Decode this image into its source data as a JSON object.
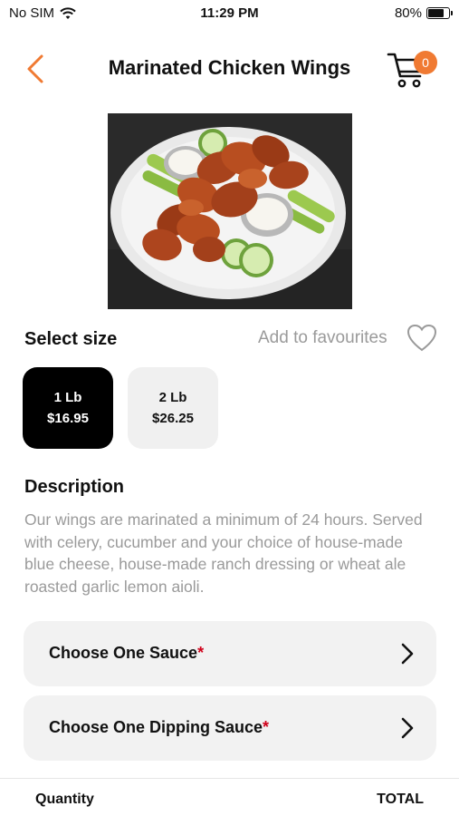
{
  "status_bar": {
    "carrier": "No SIM",
    "time": "11:29 PM",
    "battery_percent": "80%",
    "battery_level": 0.8
  },
  "nav": {
    "title": "Marinated Chicken Wings",
    "cart_count": "0",
    "accent_color": "#f07a32"
  },
  "product": {
    "image_icon": "food-photo-chicken-wings"
  },
  "size_section": {
    "label": "Select size",
    "favourites_label": "Add to favourites",
    "options": [
      {
        "size": "1 Lb",
        "price": "$16.95",
        "selected": true
      },
      {
        "size": "2 Lb",
        "price": "$26.25",
        "selected": false
      }
    ]
  },
  "description": {
    "title": "Description",
    "text": "Our wings are marinated a minimum of 24 hours. Served with celery, cucumber and your choice of house-made blue cheese, house-made ranch dressing or wheat ale roasted garlic lemon aioli."
  },
  "options": [
    {
      "label": "Choose One Sauce",
      "required_mark": "*"
    },
    {
      "label": "Choose One Dipping Sauce",
      "required_mark": "*"
    }
  ],
  "footer": {
    "quantity_label": "Quantity",
    "total_label": "TOTAL"
  }
}
